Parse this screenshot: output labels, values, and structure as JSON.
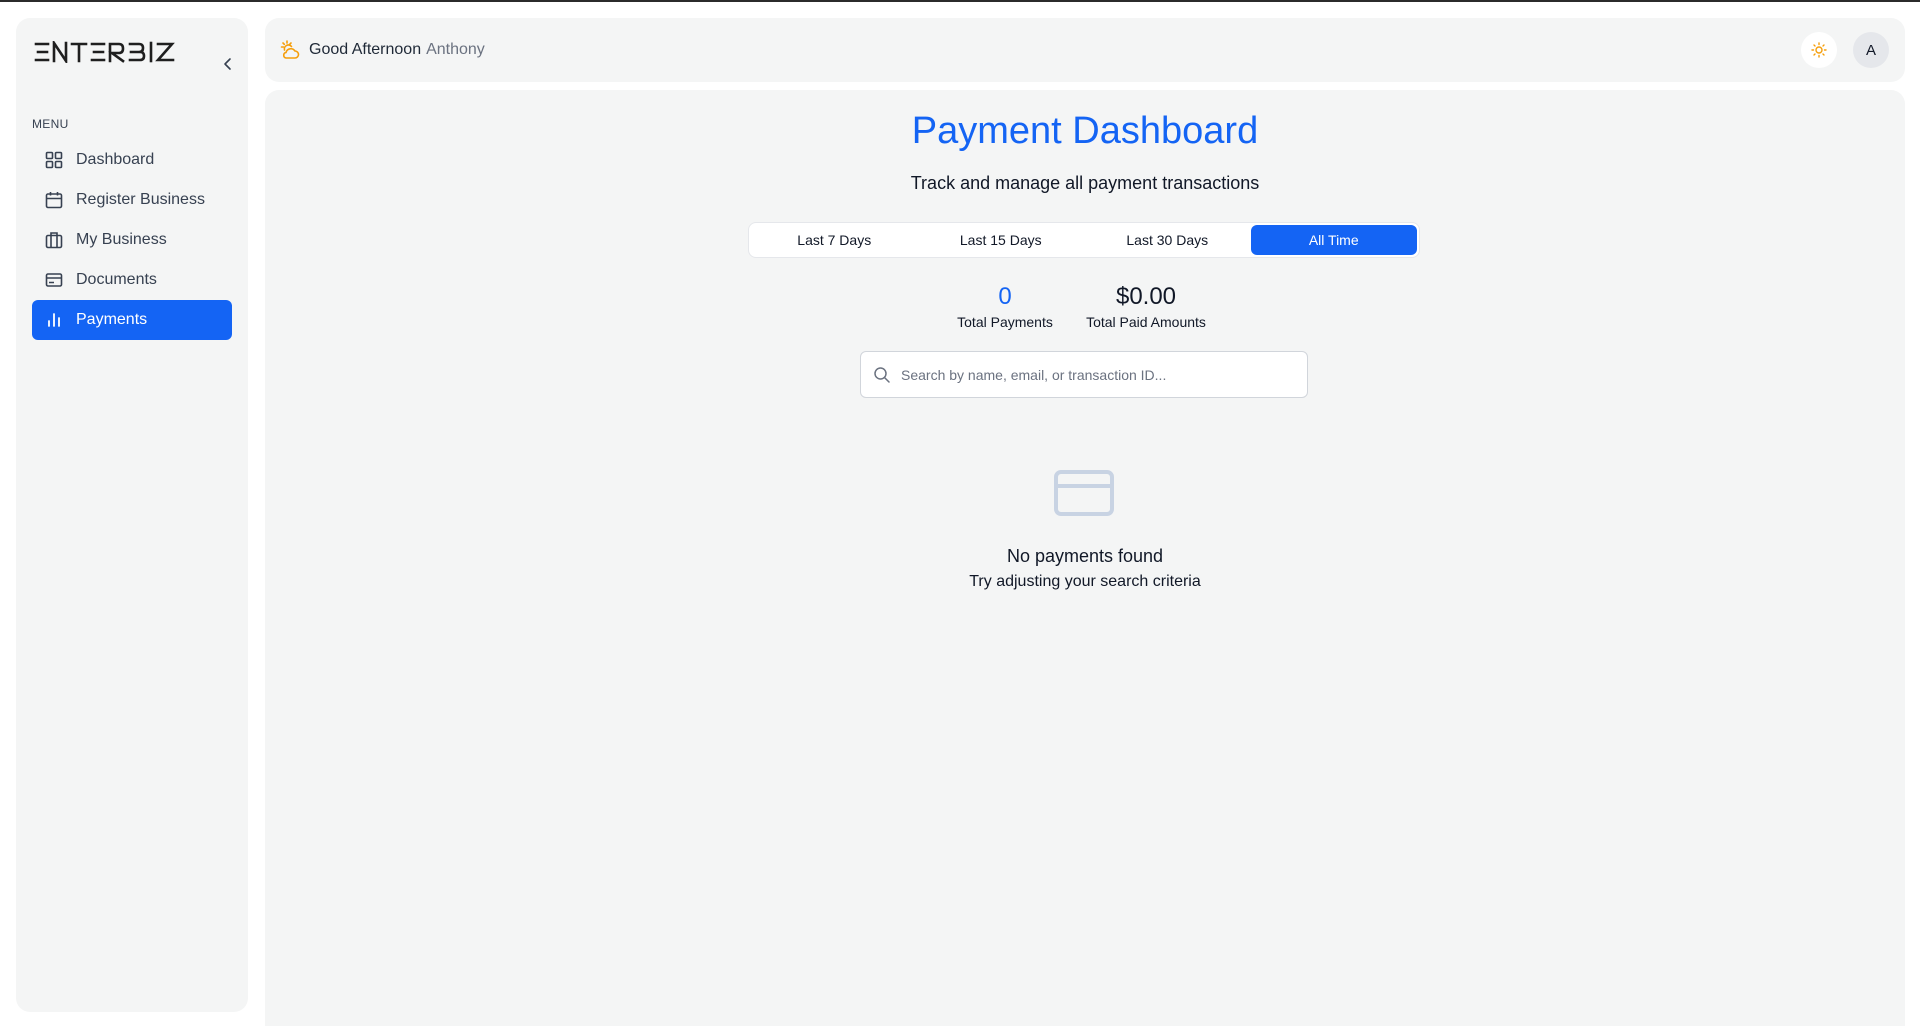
{
  "app": {
    "logo_text": "ENTERBIZ",
    "brand_color": "#1464f4"
  },
  "sidebar": {
    "menu_label": "MENU",
    "items": [
      {
        "label": "Dashboard",
        "icon": "grid-icon",
        "active": false
      },
      {
        "label": "Register Business",
        "icon": "calendar-icon",
        "active": false
      },
      {
        "label": "My Business",
        "icon": "briefcase-icon",
        "active": false
      },
      {
        "label": "Documents",
        "icon": "credit-card-icon",
        "active": false
      },
      {
        "label": "Payments",
        "icon": "bar-chart-icon",
        "active": true
      }
    ]
  },
  "header": {
    "greeting": "Good Afternoon",
    "user_name": "Anthony",
    "avatar_initial": "A",
    "theme_icon": "sun-icon",
    "greeting_icon": "sun-cloud-icon"
  },
  "main": {
    "title": "Payment Dashboard",
    "subtitle": "Track and manage all payment transactions",
    "tabs": [
      {
        "label": "Last 7 Days",
        "active": false
      },
      {
        "label": "Last 15 Days",
        "active": false
      },
      {
        "label": "Last 30 Days",
        "active": false
      },
      {
        "label": "All Time",
        "active": true
      }
    ],
    "stats": {
      "total_payments_value": "0",
      "total_payments_label": "Total Payments",
      "total_paid_value": "$0.00",
      "total_paid_label": "Total Paid Amounts"
    },
    "search": {
      "placeholder": "Search by name, email, or transaction ID...",
      "value": ""
    },
    "empty_state": {
      "icon": "credit-card-icon",
      "title": "No payments found",
      "subtitle": "Try adjusting your search criteria"
    }
  }
}
